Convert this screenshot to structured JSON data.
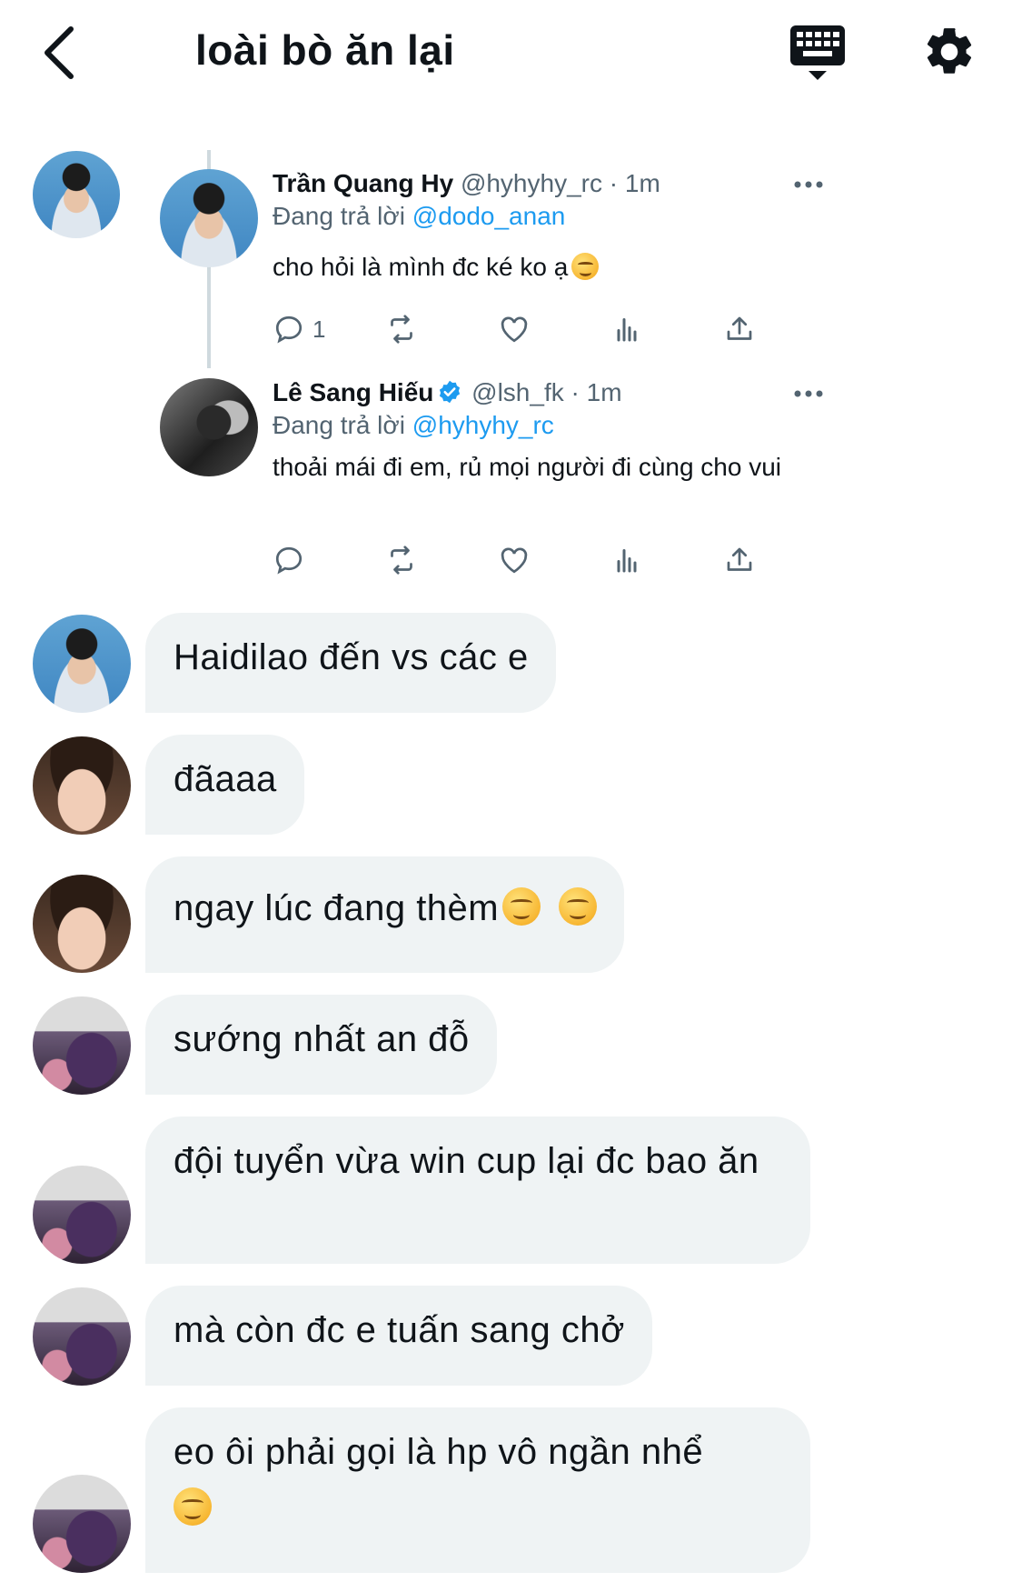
{
  "header": {
    "title": "loài bò ăn lại",
    "back_icon": "chevron-left-icon",
    "keyboard_icon": "keyboard-icon",
    "settings_icon": "gear-icon"
  },
  "thread": [
    {
      "name": "Trần Quang Hy",
      "handle": "@hyhyhy_rc",
      "time": "· 1m",
      "reply_prefix": "Đang trả lời",
      "reply_to": "@dodo_anan",
      "text": "cho hỏi là mình đc ké ko ạ",
      "emoji": "😊",
      "reply_count": "1",
      "verified": false
    },
    {
      "name": "Lê Sang Hiếu",
      "handle": "@lsh_fk",
      "time": "· 1m",
      "reply_prefix": "Đang trả lời",
      "reply_to": "@hyhyhy_rc",
      "text": "thoải mái đi em, rủ mọi người đi cùng cho vui",
      "reply_count": "",
      "verified": true
    }
  ],
  "messages": [
    {
      "text": "Haidilao đến vs các e"
    },
    {
      "text": "đãaaa"
    },
    {
      "text": "ngay lúc đang thèm",
      "emojis": [
        "😋",
        "😋"
      ]
    },
    {
      "text": "sướng nhất an đỗ"
    },
    {
      "text": "đội tuyển vừa win cup lại đc bao ăn"
    },
    {
      "text": "mà còn đc e tuấn sang chở"
    },
    {
      "text": "eo ôi phải gọi là hp vô ngần nhể",
      "emojis": [
        "😏"
      ]
    }
  ],
  "colors": {
    "accent": "#1d9bf0",
    "bubble": "#eff3f4",
    "text": "#0f1419",
    "muted": "#536471"
  }
}
